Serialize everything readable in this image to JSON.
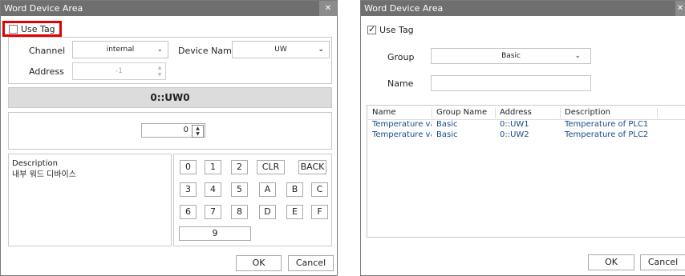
{
  "left": {
    "title": "Word Device Area",
    "close_glyph": "✕",
    "use_tag_label": "Use Tag",
    "channel_label": "Channel",
    "channel_value": "internal",
    "device_name_label": "Device Name",
    "device_name_value": "UW",
    "address_label": "Address",
    "address_value": "-1",
    "address_display": "0::UW0",
    "value_input": "0",
    "description_label": "Description",
    "description_text": "내부 워드 디바이스",
    "keypad": [
      "0",
      "1",
      "2",
      "CLR",
      "BACK",
      "3",
      "4",
      "5",
      "A",
      "B",
      "C",
      "6",
      "7",
      "8",
      "D",
      "E",
      "F",
      "9"
    ],
    "ok_label": "OK",
    "cancel_label": "Cancel",
    "highlight_color": "#e00000"
  },
  "right": {
    "title": "Word Device Area",
    "close_glyph": "✕",
    "use_tag_label": "Use Tag",
    "group_label": "Group",
    "group_value": "Basic",
    "name_label": "Name",
    "name_value": "",
    "columns": [
      "Name",
      "Group Name",
      "Address",
      "Description"
    ],
    "rows": [
      [
        "Temperature va",
        "Basic",
        "0::UW1",
        "Temperature of PLC1"
      ],
      [
        "Temperature va",
        "Basic",
        "0::UW2",
        "Temperature of PLC2"
      ]
    ],
    "ok_label": "OK",
    "cancel_label": "Cancel"
  }
}
